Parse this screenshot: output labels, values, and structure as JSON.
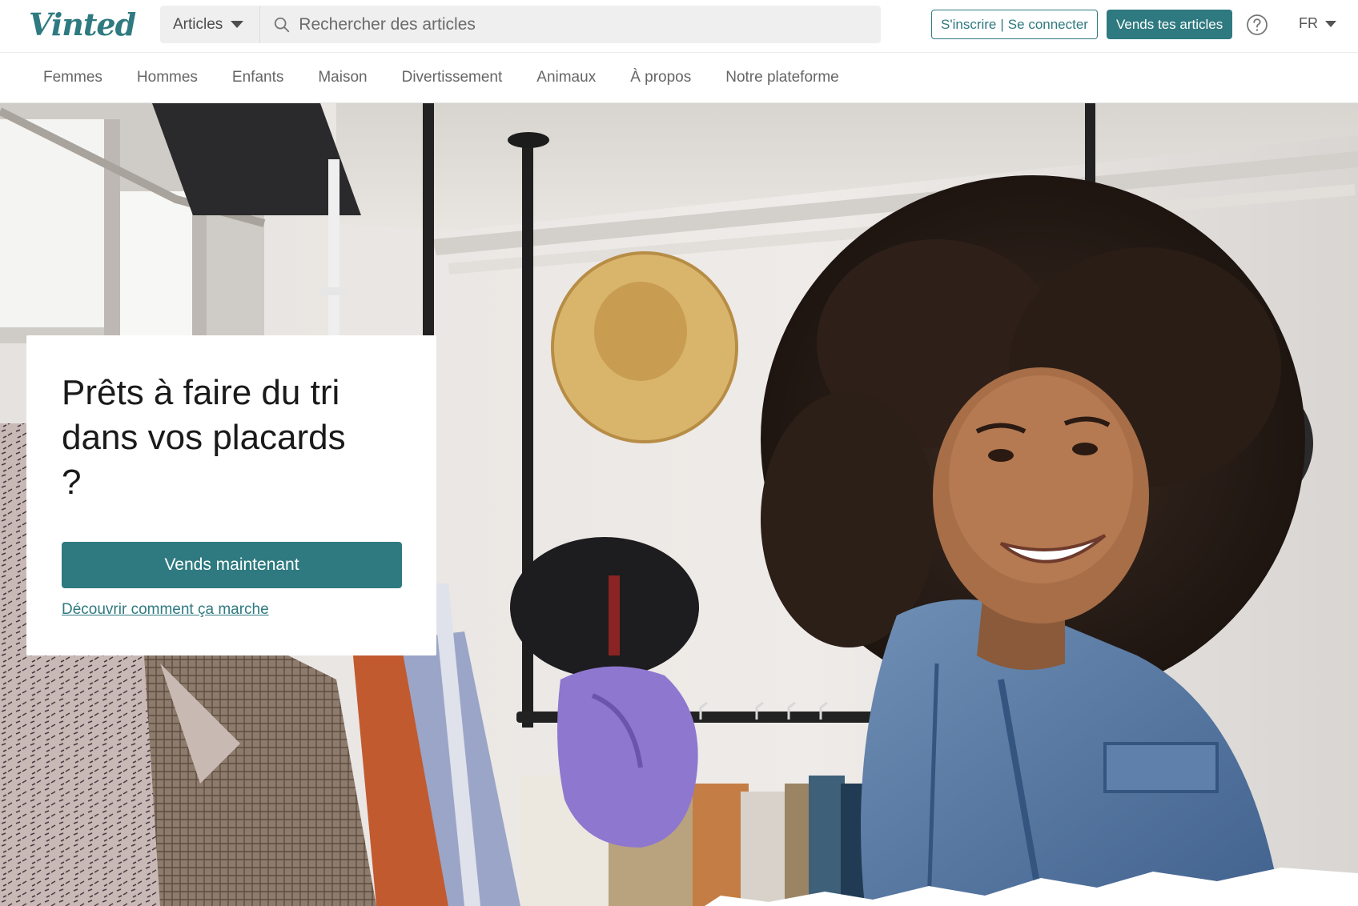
{
  "header": {
    "logo": "Vinted",
    "category_select": "Articles",
    "search_placeholder": "Rechercher des articles",
    "signup_label": "S'inscrire",
    "login_label": "Se connecter",
    "separator": "|",
    "sell_label": "Vends tes articles",
    "language": "FR"
  },
  "nav": {
    "items": [
      "Femmes",
      "Hommes",
      "Enfants",
      "Maison",
      "Divertissement",
      "Animaux",
      "À propos",
      "Notre plateforme"
    ]
  },
  "hero": {
    "title": "Prêts à faire du tri dans vos placards ?",
    "cta_label": "Vends maintenant",
    "link_label": "Découvrir comment ça marche"
  },
  "colors": {
    "brand": "#2f7a80",
    "search_bg": "#efefef",
    "nav_text": "#666666"
  },
  "icons": {
    "search": "search-icon",
    "help": "help-icon",
    "caret": "chevron-down-icon"
  }
}
